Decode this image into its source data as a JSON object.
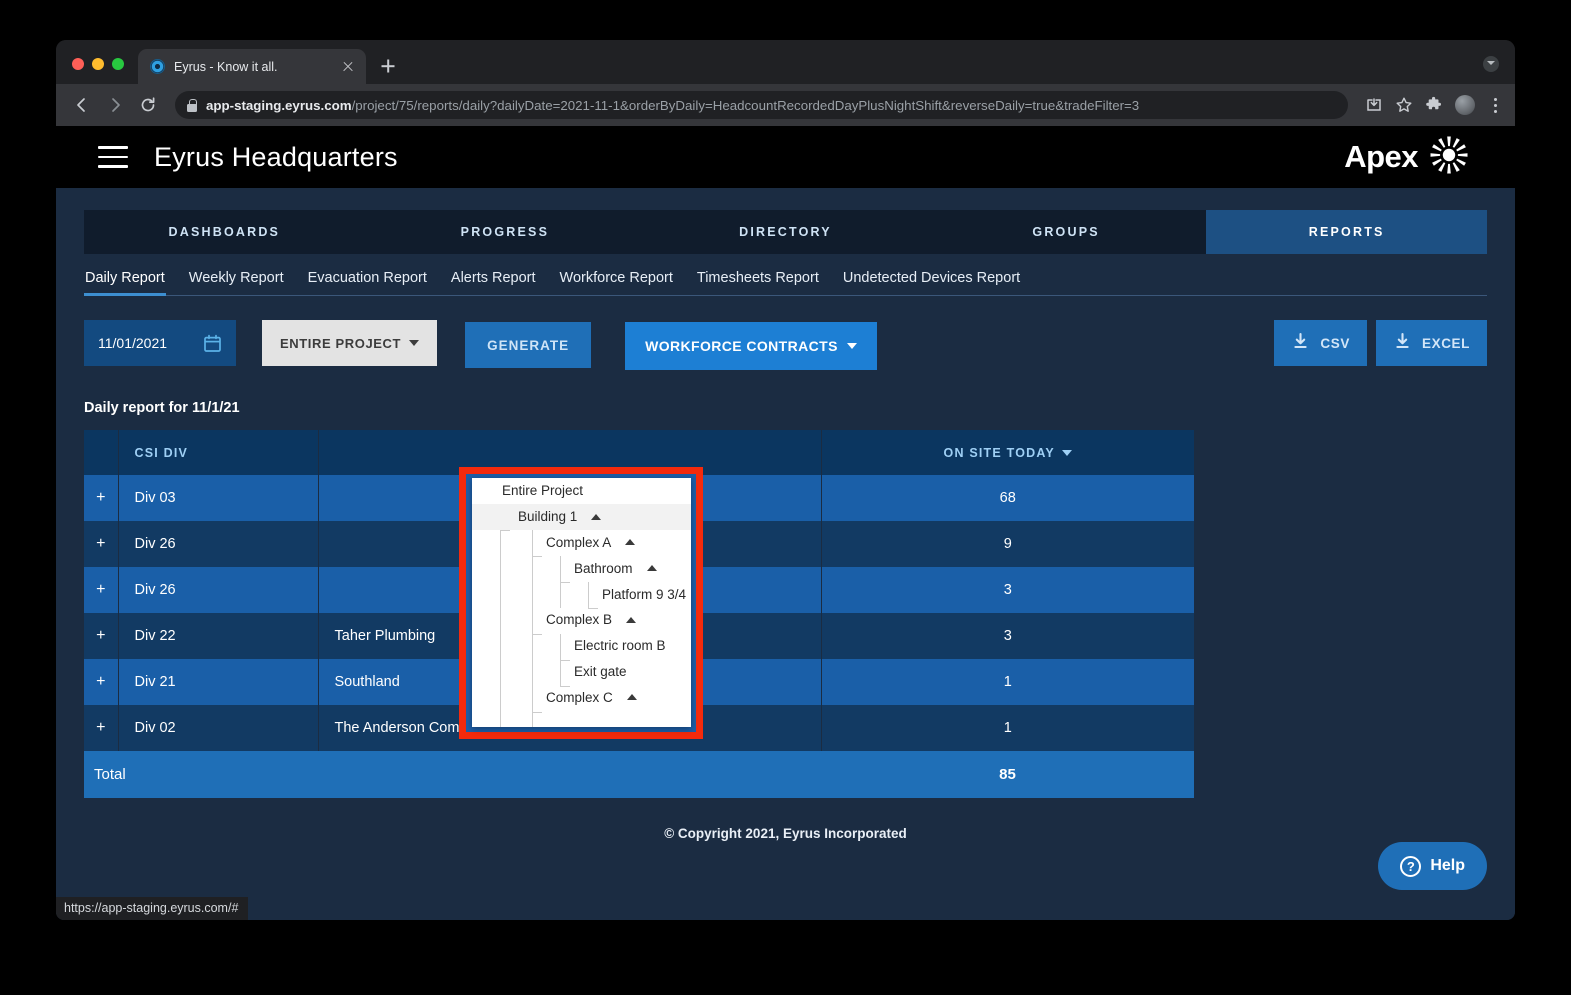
{
  "browser": {
    "tab": {
      "title": "Eyrus - Know it all.",
      "favicon": "eyrus-favicon"
    },
    "new_tab_label": "+",
    "omnibox": {
      "host": "app-staging.eyrus.com",
      "path": "/project/75/reports/daily?dailyDate=2021-11-1&orderByDaily=HeadcountRecordedDayPlusNightShift&reverseDaily=true&tradeFilter=3"
    },
    "status_link": "https://app-staging.eyrus.com/#"
  },
  "appbar": {
    "title": "Eyrus Headquarters",
    "brand": "Apex"
  },
  "mainnav": {
    "items": [
      {
        "label": "DASHBOARDS",
        "active": false
      },
      {
        "label": "PROGRESS",
        "active": false
      },
      {
        "label": "DIRECTORY",
        "active": false
      },
      {
        "label": "GROUPS",
        "active": false
      },
      {
        "label": "REPORTS",
        "active": true
      }
    ]
  },
  "subnav": {
    "items": [
      {
        "label": "Daily Report",
        "active": true
      },
      {
        "label": "Weekly Report",
        "active": false
      },
      {
        "label": "Evacuation Report",
        "active": false
      },
      {
        "label": "Alerts Report",
        "active": false
      },
      {
        "label": "Workforce Report",
        "active": false
      },
      {
        "label": "Timesheets Report",
        "active": false
      },
      {
        "label": "Undetected Devices Report",
        "active": false
      }
    ]
  },
  "controls": {
    "date_value": "11/01/2021",
    "project_selector_label": "ENTIRE PROJECT",
    "generate_label": "GENERATE",
    "contracts_label": "WORKFORCE CONTRACTS",
    "csv_label": "CSV",
    "excel_label": "EXCEL"
  },
  "dropdown": {
    "rows": [
      {
        "label": "Entire Project",
        "depth": 0,
        "caret": false,
        "highlight": false
      },
      {
        "label": "Building 1",
        "depth": 1,
        "caret": true,
        "highlight": true
      },
      {
        "label": "Complex A",
        "depth": 2,
        "caret": true,
        "highlight": false
      },
      {
        "label": "Bathroom",
        "depth": 3,
        "caret": true,
        "highlight": false
      },
      {
        "label": "Platform 9 3/4",
        "depth": 4,
        "caret": false,
        "highlight": false
      },
      {
        "label": "Complex B",
        "depth": 2,
        "caret": true,
        "highlight": false
      },
      {
        "label": "Electric room B",
        "depth": 3,
        "caret": false,
        "highlight": false
      },
      {
        "label": "Exit gate",
        "depth": 3,
        "caret": false,
        "highlight": false
      },
      {
        "label": "Complex C",
        "depth": 2,
        "caret": true,
        "highlight": false
      }
    ]
  },
  "report": {
    "title": "Daily report for 11/1/21",
    "columns": [
      "",
      "CSI DIV",
      "",
      "ON SITE TODAY"
    ],
    "rows": [
      {
        "expand": "+",
        "div": "Div 03",
        "contractor": "",
        "count": "68"
      },
      {
        "expand": "+",
        "div": "Div 26",
        "contractor": "",
        "count": "9"
      },
      {
        "expand": "+",
        "div": "Div 26",
        "contractor": "",
        "count": "3"
      },
      {
        "expand": "+",
        "div": "Div 22",
        "contractor": "Taher Plumbing",
        "count": "3"
      },
      {
        "expand": "+",
        "div": "Div 21",
        "contractor": "Southland",
        "count": "1"
      },
      {
        "expand": "+",
        "div": "Div 02",
        "contractor": "The Anderson Company",
        "count": "1"
      }
    ],
    "total_label": "Total",
    "total_value": "85"
  },
  "footer": {
    "copyright": "© Copyright 2021, Eyrus Incorporated"
  },
  "help": {
    "label": "Help",
    "icon": "question-circle-icon"
  },
  "colors": {
    "accent_blue": "#1f6fb7",
    "nav_active": "#1d5083",
    "page_bg": "#1b2c42",
    "row_odd": "#1a5fa8",
    "row_even": "#123a63",
    "header_row": "#0b3660",
    "highlight_red": "#f42a0c",
    "contracts_blue": "#1d7fd4"
  }
}
